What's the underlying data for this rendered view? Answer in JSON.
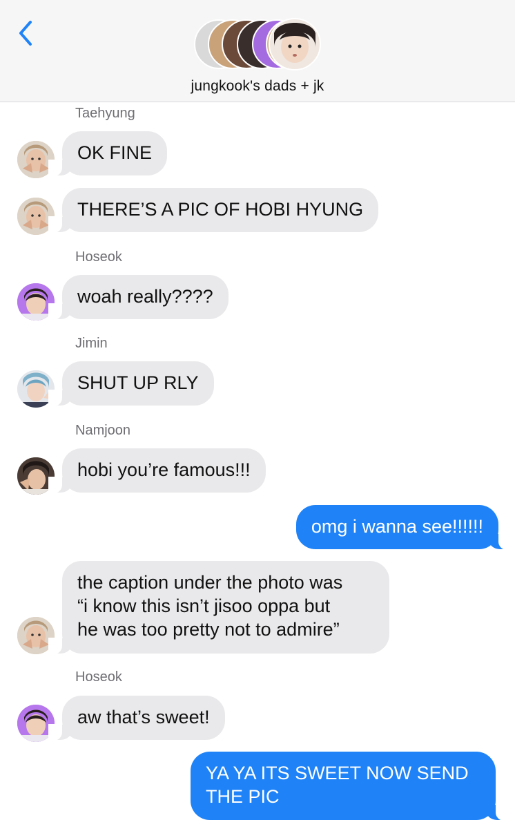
{
  "header": {
    "group_title": "jungkook's dads + jk",
    "back_icon": "chevron-left-icon",
    "accent_color": "#1f83f7"
  },
  "messages": [
    {
      "sender": "Taehyung",
      "text": "OK FINE"
    },
    {
      "text": "THERE’S A PIC OF HOBI HYUNG"
    },
    {
      "sender": "Hoseok",
      "text": "woah really????"
    },
    {
      "sender": "Jimin",
      "text": "SHUT UP RLY"
    },
    {
      "sender": "Namjoon",
      "text": "hobi you’re famous!!!"
    },
    {
      "outgoing": true,
      "text": "omg i wanna see!!!!!!"
    },
    {
      "lines": [
        "the caption under the photo was",
        "“i know this isn’t jisoo oppa but",
        "he was too pretty not to admire”"
      ]
    },
    {
      "sender": "Hoseok",
      "text": "aw that’s sweet!"
    },
    {
      "outgoing": true,
      "lines": [
        "YA YA ITS SWEET NOW SEND",
        "THE PIC"
      ]
    }
  ],
  "colors": {
    "incoming_bubble": "#e9e9eb",
    "outgoing_bubble": "#1f83f7"
  }
}
